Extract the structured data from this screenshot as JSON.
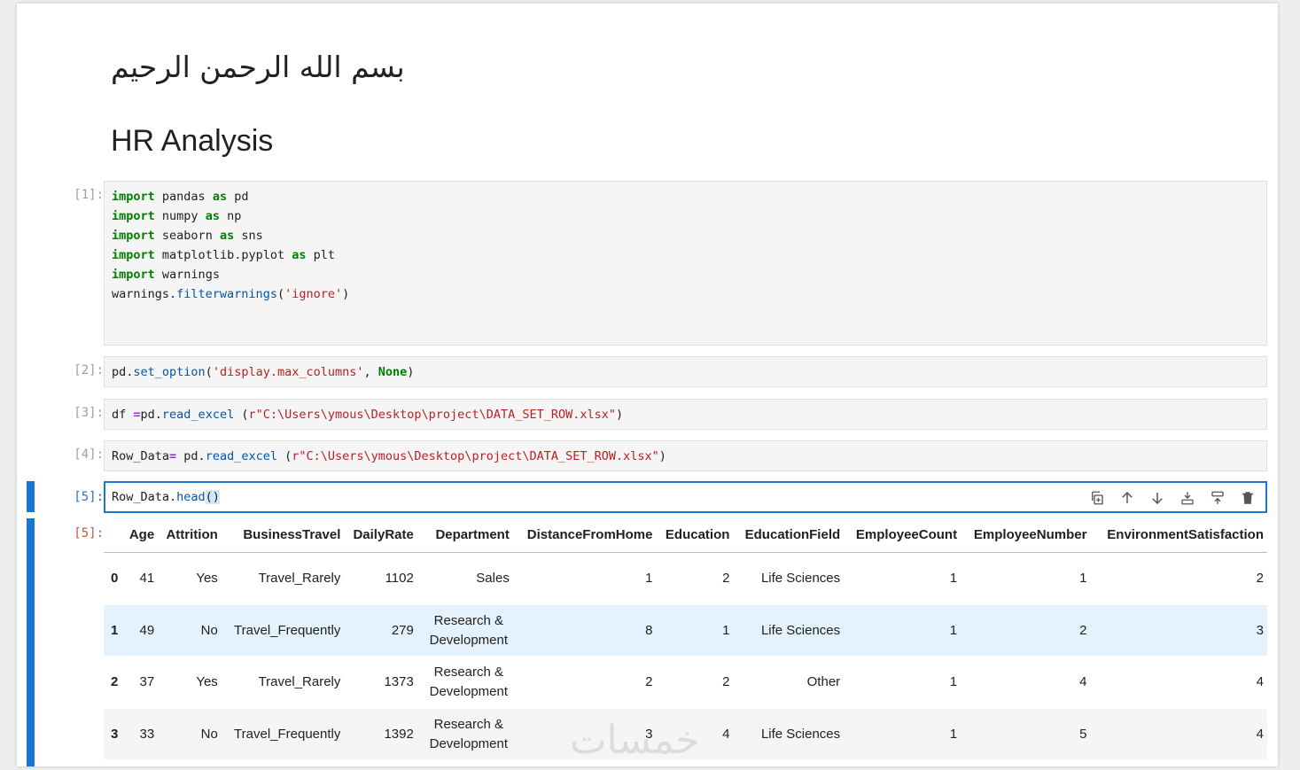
{
  "markdown": {
    "arabic_heading": "بسم الله الرحمن الرحيم",
    "title": "HR Analysis"
  },
  "cells": [
    {
      "prompt": "[1]:"
    },
    {
      "prompt": "[2]:"
    },
    {
      "prompt": "[3]:"
    },
    {
      "prompt": "[4]:"
    },
    {
      "prompt": "[5]:"
    }
  ],
  "code": {
    "c1": {
      "import": "import",
      "as": "as",
      "lines": [
        {
          "mod": "pandas",
          "alias": "pd"
        },
        {
          "mod": "numpy",
          "alias": "np"
        },
        {
          "mod": "seaborn",
          "alias": "sns"
        },
        {
          "mod": "matplotlib.pyplot",
          "alias": "plt"
        }
      ],
      "warnings_mod": "warnings",
      "warn_obj": "warnings.",
      "warn_fn": "filterwarnings",
      "warn_open": "(",
      "warn_arg": "'ignore'",
      "warn_close": ")"
    },
    "c2": {
      "obj": "pd.",
      "fn": "set_option",
      "open": "(",
      "arg": "'display.max_columns'",
      "sep": ", ",
      "none": "None",
      "close": ")"
    },
    "c3": {
      "var": "df ",
      "eq": "=",
      "obj": "pd.",
      "fn": "read_excel",
      "open": " (",
      "prefix": "r",
      "path": "\"C:\\Users\\ymous\\Desktop\\project\\DATA_SET_ROW.xlsx\"",
      "close": ")"
    },
    "c4": {
      "var": "Row_Data",
      "eq": "=",
      "obj": " pd.",
      "fn": "read_excel",
      "open": " (",
      "prefix": "r",
      "path": "\"C:\\Users\\ymous\\Desktop\\project\\DATA_SET_ROW.xlsx\"",
      "close": ")"
    },
    "c5": {
      "obj": "Row_Data.",
      "fn": "head",
      "parens": "()"
    }
  },
  "output_prompt": "[5]:",
  "table": {
    "columns": [
      "Age",
      "Attrition",
      "BusinessTravel",
      "DailyRate",
      "Department",
      "DistanceFromHome",
      "Education",
      "EducationField",
      "EmployeeCount",
      "EmployeeNumber",
      "EnvironmentSatisfaction"
    ],
    "rows": [
      {
        "idx": "0",
        "cells": [
          "41",
          "Yes",
          "Travel_Rarely",
          "1102",
          "Sales",
          "1",
          "2",
          "Life Sciences",
          "1",
          "1",
          "2"
        ]
      },
      {
        "idx": "1",
        "cells": [
          "49",
          "No",
          "Travel_Frequently",
          "279",
          "Research & Development",
          "8",
          "1",
          "Life Sciences",
          "1",
          "2",
          "3"
        ]
      },
      {
        "idx": "2",
        "cells": [
          "37",
          "Yes",
          "Travel_Rarely",
          "1373",
          "Research & Development",
          "2",
          "2",
          "Other",
          "1",
          "4",
          "4"
        ]
      },
      {
        "idx": "3",
        "cells": [
          "33",
          "No",
          "Travel_Frequently",
          "1392",
          "Research & Development",
          "3",
          "4",
          "Life Sciences",
          "1",
          "5",
          "4"
        ]
      }
    ]
  },
  "toolbar_icons": [
    "duplicate-icon",
    "arrow-up-icon",
    "arrow-down-icon",
    "insert-above-icon",
    "insert-below-icon",
    "delete-icon"
  ],
  "watermark": "خمسات",
  "colors": {
    "accent": "#1976d2",
    "keyword": "#008000",
    "string": "#ba2121",
    "function": "#0055aa"
  }
}
